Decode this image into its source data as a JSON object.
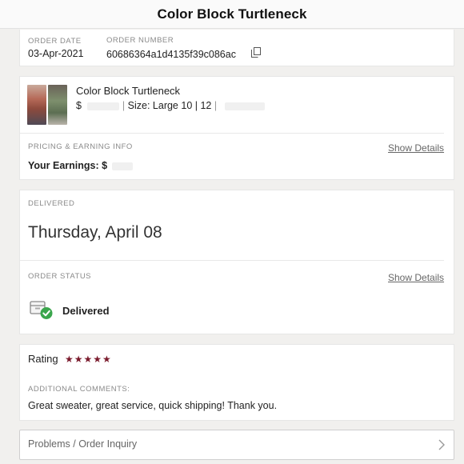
{
  "header": {
    "title": "Color Block Turtleneck"
  },
  "order": {
    "date_label": "ORDER DATE",
    "date_value": "03-Apr-2021",
    "number_label": "ORDER NUMBER",
    "number_value": "60686364a1d4135f39c086ac",
    "copy_icon": "copy-icon"
  },
  "item": {
    "name": "Color Block Turtleneck",
    "price_prefix": "$",
    "size_text": "Size: Large 10 | 12",
    "pricing_label": "PRICING & EARNING INFO",
    "show_details": "Show Details",
    "earnings_label": "Your Earnings: $"
  },
  "delivery": {
    "status_heading": "DELIVERED",
    "date": "Thursday, April 08",
    "order_status_label": "ORDER STATUS",
    "show_details": "Show Details",
    "status_value": "Delivered",
    "status_icon": "delivered-box-check-icon",
    "accent_green": "#3aa64c"
  },
  "rating": {
    "label": "Rating",
    "stars": "★★★★★",
    "star_color": "#7a1a2c",
    "comments_label": "ADDITIONAL COMMENTS:",
    "comment": "Great sweater, great service, quick shipping! Thank you."
  },
  "inquiry": {
    "label": "Problems / Order Inquiry",
    "icon": "chevron-right-icon"
  }
}
